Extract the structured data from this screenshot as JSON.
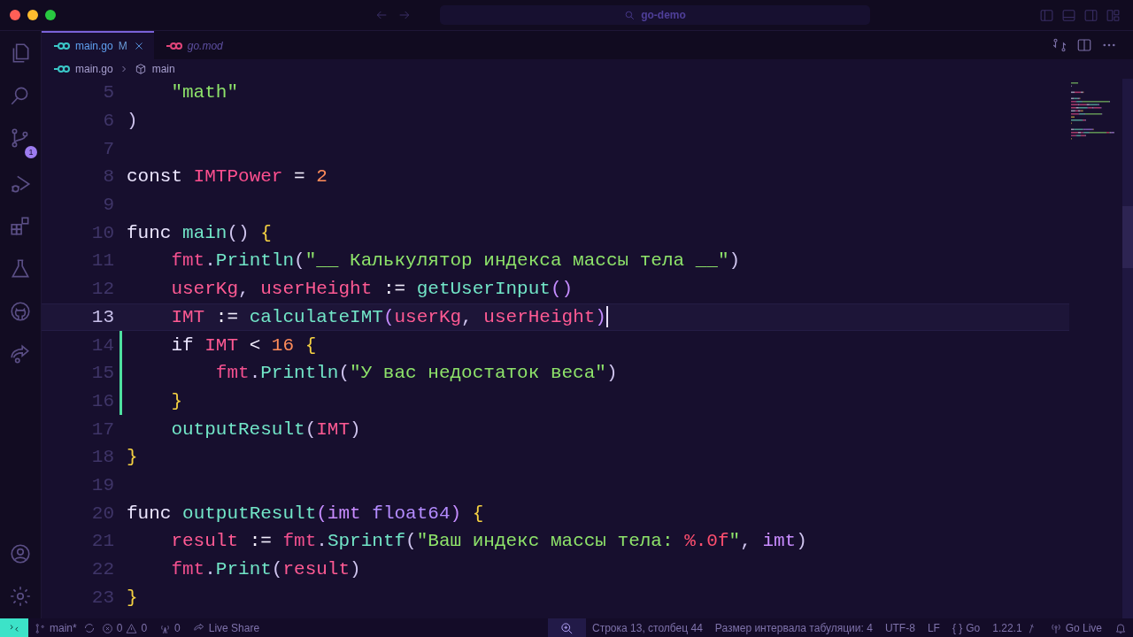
{
  "window": {
    "title": "go-demo"
  },
  "activity_bar": {
    "badge": "1"
  },
  "tabs": [
    {
      "label": "main.go",
      "badge": "M",
      "selected": true,
      "preview": false
    },
    {
      "label": "go.mod",
      "selected": false,
      "preview": true
    }
  ],
  "breadcrumb": [
    "main.go",
    "main"
  ],
  "editor": {
    "lines": [
      {
        "number": "5",
        "tokens": [
          {
            "text": "    \"math\"",
            "kind": "str"
          }
        ]
      },
      {
        "number": "6",
        "tokens": [
          {
            "text": ")",
            "kind": "punct"
          }
        ]
      },
      {
        "number": "7"
      },
      {
        "number": "8",
        "tokens": [
          {
            "text": "const",
            "kind": "kw"
          },
          {
            "text": " IMTPower",
            "kind": "const"
          },
          {
            "text": " = ",
            "kind": "op"
          },
          {
            "text": "2",
            "kind": "num"
          }
        ]
      },
      {
        "number": "9"
      },
      {
        "number": "10",
        "tokens": [
          {
            "text": "func",
            "kind": "kw"
          },
          {
            "text": " main",
            "kind": "fn"
          },
          {
            "text": "() ",
            "kind": "punct"
          },
          {
            "text": "{",
            "kind": "brace"
          }
        ]
      },
      {
        "number": "11",
        "tokens": [
          {
            "text": "    fmt",
            "kind": "pkg"
          },
          {
            "text": ".",
            "kind": "punct"
          },
          {
            "text": "Println",
            "kind": "fn"
          },
          {
            "text": "(",
            "kind": "punct"
          },
          {
            "text": "\"__ Калькулятор индекса массы тела __\"",
            "kind": "str"
          },
          {
            "text": ")",
            "kind": "punct"
          }
        ]
      },
      {
        "number": "12",
        "tokens": [
          {
            "text": "    userKg",
            "kind": "var"
          },
          {
            "text": ", ",
            "kind": "punct"
          },
          {
            "text": "userHeight",
            "kind": "var"
          },
          {
            "text": " := ",
            "kind": "op"
          },
          {
            "text": "getUserInput",
            "kind": "fn"
          },
          {
            "text": "()",
            "kind": "paren"
          }
        ]
      },
      {
        "number": "13",
        "current": true,
        "tokens": [
          {
            "text": "    IMT",
            "kind": "var"
          },
          {
            "text": " := ",
            "kind": "op"
          },
          {
            "text": "calculateIMT",
            "kind": "fn"
          },
          {
            "text": "(",
            "kind": "paren"
          },
          {
            "text": "userKg",
            "kind": "var"
          },
          {
            "text": ", ",
            "kind": "punct"
          },
          {
            "text": "userHeight",
            "kind": "var"
          },
          {
            "text": ")",
            "kind": "paren"
          }
        ]
      },
      {
        "number": "14",
        "changed": true,
        "tokens": [
          {
            "text": "    if",
            "kind": "kw"
          },
          {
            "text": " IMT",
            "kind": "var"
          },
          {
            "text": " < ",
            "kind": "op"
          },
          {
            "text": "16",
            "kind": "num"
          },
          {
            "text": " {",
            "kind": "brace"
          }
        ]
      },
      {
        "number": "15",
        "changed": true,
        "tokens": [
          {
            "text": "        fmt",
            "kind": "pkg"
          },
          {
            "text": ".",
            "kind": "punct"
          },
          {
            "text": "Println",
            "kind": "fn"
          },
          {
            "text": "(",
            "kind": "punct"
          },
          {
            "text": "\"У вас недостаток веса\"",
            "kind": "str"
          },
          {
            "text": ")",
            "kind": "punct"
          }
        ]
      },
      {
        "number": "16",
        "changed": true,
        "tokens": [
          {
            "text": "    }",
            "kind": "brace"
          }
        ]
      },
      {
        "number": "17",
        "tokens": [
          {
            "text": "    outputResult",
            "kind": "fn"
          },
          {
            "text": "(",
            "kind": "punct"
          },
          {
            "text": "IMT",
            "kind": "var"
          },
          {
            "text": ")",
            "kind": "punct"
          }
        ]
      },
      {
        "number": "18",
        "tokens": [
          {
            "text": "}",
            "kind": "brace"
          }
        ]
      },
      {
        "number": "19"
      },
      {
        "number": "20",
        "tokens": [
          {
            "text": "func",
            "kind": "kw"
          },
          {
            "text": " outputResult",
            "kind": "fn"
          },
          {
            "text": "(",
            "kind": "paren"
          },
          {
            "text": "imt",
            "kind": "param"
          },
          {
            "text": " float64",
            "kind": "type"
          },
          {
            "text": ") ",
            "kind": "paren"
          },
          {
            "text": "{",
            "kind": "brace"
          }
        ]
      },
      {
        "number": "21",
        "tokens": [
          {
            "text": "    result",
            "kind": "var"
          },
          {
            "text": " := ",
            "kind": "op"
          },
          {
            "text": "fmt",
            "kind": "pkg"
          },
          {
            "text": ".",
            "kind": "punct"
          },
          {
            "text": "Sprintf",
            "kind": "fn"
          },
          {
            "text": "(",
            "kind": "punct"
          },
          {
            "text": "\"Ваш индекс массы тела: ",
            "kind": "str"
          },
          {
            "text": "%.0f",
            "kind": "fmt"
          },
          {
            "text": "\"",
            "kind": "str"
          },
          {
            "text": ", ",
            "kind": "punct"
          },
          {
            "text": "imt",
            "kind": "param"
          },
          {
            "text": ")",
            "kind": "punct"
          }
        ]
      },
      {
        "number": "22",
        "tokens": [
          {
            "text": "    fmt",
            "kind": "pkg"
          },
          {
            "text": ".",
            "kind": "punct"
          },
          {
            "text": "Print",
            "kind": "fn"
          },
          {
            "text": "(",
            "kind": "punct"
          },
          {
            "text": "result",
            "kind": "var"
          },
          {
            "text": ")",
            "kind": "punct"
          }
        ]
      },
      {
        "number": "23",
        "tokens": [
          {
            "text": "}",
            "kind": "brace"
          }
        ]
      }
    ]
  },
  "status_bar": {
    "left": {
      "branch": "main*",
      "errors": "0",
      "warnings": "0",
      "ports": "0",
      "live_share": "Live Share"
    },
    "right": {
      "position": "Строка 13, столбец 44",
      "indent": "Размер интервала табуляции: 4",
      "encoding": "UTF-8",
      "eol": "LF",
      "language_icon": "{ }",
      "language": "Go",
      "version": "1.22.1",
      "go_live": "Go Live"
    }
  }
}
